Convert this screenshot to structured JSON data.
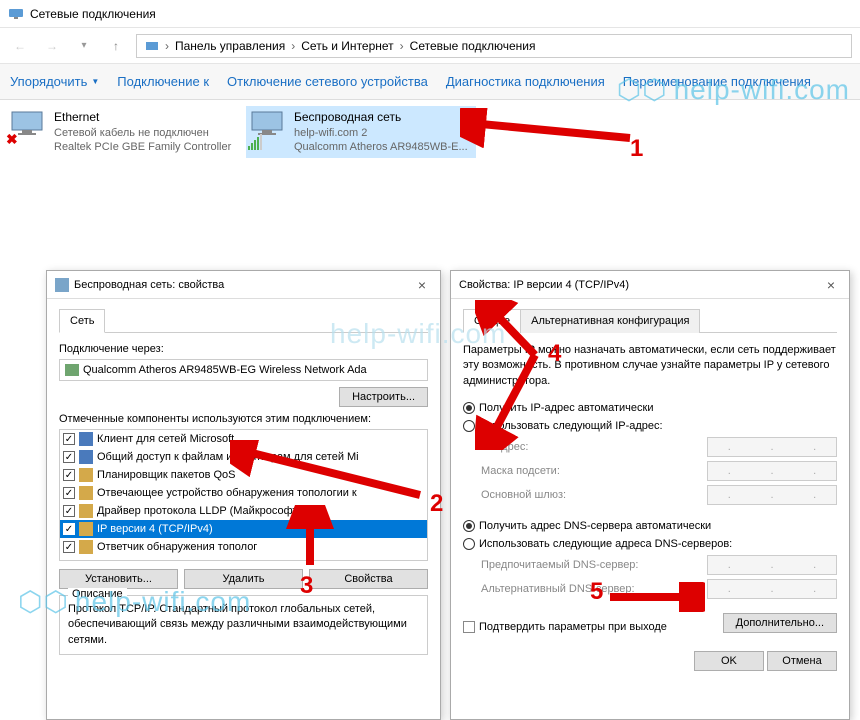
{
  "window": {
    "title": "Сетевые подключения"
  },
  "breadcrumb": {
    "a": "Панель управления",
    "b": "Сеть и Интернет",
    "c": "Сетевые подключения"
  },
  "toolbar": {
    "organize": "Упорядочить",
    "connect": "Подключение к",
    "disable": "Отключение сетевого устройства",
    "diagnose": "Диагностика подключения",
    "rename": "Переименование подключения"
  },
  "adapters": [
    {
      "name": "Ethernet",
      "status": "Сетевой кабель не подключен",
      "device": "Realtek PCIe GBE Family Controller"
    },
    {
      "name": "Беспроводная сеть",
      "status": "help-wifi.com  2",
      "device": "Qualcomm Atheros AR9485WB-E..."
    }
  ],
  "dialog1": {
    "title": "Беспроводная сеть: свойства",
    "tab": "Сеть",
    "connect_using": "Подключение через:",
    "adapter": "Qualcomm Atheros AR9485WB-EG Wireless Network Ada",
    "configure": "Настроить...",
    "components_label": "Отмеченные компоненты используются этим подключением:",
    "components": [
      "Клиент для сетей Microsoft",
      "Общий доступ к файлам и принтерам для сетей Mi",
      "Планировщик пакетов QoS",
      "Отвечающее устройство обнаружения топологии к",
      "Драйвер протокола LLDP (Майкрософт)",
      "IP версии 4 (TCP/IPv4)",
      "Ответчик обнаружения тополог"
    ],
    "install": "Установить...",
    "remove": "Удалить",
    "properties": "Свойства",
    "desc_title": "Описание",
    "desc": "Протокол TCP/IP. Стандартный протокол глобальных сетей, обеспечивающий связь между различными взаимодействующими сетями."
  },
  "dialog2": {
    "title": "Свойства: IP версии 4 (TCP/IPv4)",
    "tab1": "Общие",
    "tab2": "Альтернативная конфигурация",
    "intro": "Параметры IP можно назначать автоматически, если сеть поддерживает эту возможность. В противном случае узнайте параметры IP у сетевого администратора.",
    "ip_auto": "Получить IP-адрес автоматически",
    "ip_manual": "Использовать следующий IP-адрес:",
    "ip_addr": "IP-адрес:",
    "mask": "Маска подсети:",
    "gateway": "Основной шлюз:",
    "dns_auto": "Получить адрес DNS-сервера автоматически",
    "dns_manual": "Использовать следующие адреса DNS-серверов:",
    "dns_pref": "Предпочитаемый DNS-сервер:",
    "dns_alt": "Альтернативный DNS-сервер:",
    "validate": "Подтвердить параметры при выходе",
    "advanced": "Дополнительно...",
    "ok": "OK",
    "cancel": "Отмена"
  },
  "watermark": "help-wifi.com",
  "annotations": {
    "n1": "1",
    "n2": "2",
    "n3": "3",
    "n4": "4",
    "n5": "5"
  }
}
